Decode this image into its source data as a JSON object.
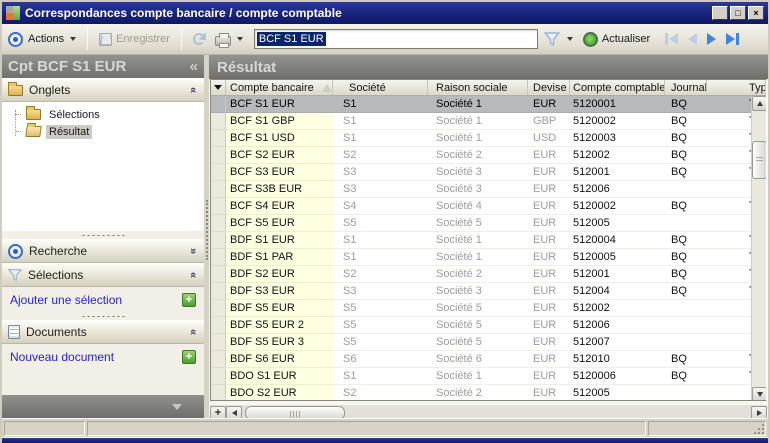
{
  "window": {
    "title": "Correspondances compte bancaire / compte comptable",
    "controls": {
      "minimize": "_",
      "maximize": "□",
      "close": "×"
    }
  },
  "toolbar": {
    "actions_label": "Actions",
    "save_label": "Enregistrer",
    "filter_value": "BCF S1 EUR",
    "refresh_label": "Actualiser"
  },
  "icons": {
    "collapse": "«",
    "expand": "»",
    "plus": "+",
    "sidebar_collapse": "«"
  },
  "sidebar": {
    "header_title": "Cpt BCF S1 EUR",
    "onglets": {
      "title": "Onglets",
      "items": [
        {
          "label": "Sélections",
          "selected": false
        },
        {
          "label": "Résultat",
          "selected": true
        }
      ]
    },
    "recherche": {
      "title": "Recherche"
    },
    "selections": {
      "title": "Sélections",
      "action_label": "Ajouter une sélection"
    },
    "documents": {
      "title": "Documents",
      "action_label": "Nouveau document"
    }
  },
  "main": {
    "header": "Résultat",
    "table": {
      "column_keys": [
        "account",
        "company",
        "company_name",
        "currency",
        "ledger_account",
        "journal",
        "type"
      ],
      "columns": [
        {
          "key": "account",
          "label": "Compte bancaire",
          "sorted": true
        },
        {
          "key": "company",
          "label": "Société",
          "sorted": false
        },
        {
          "key": "company_name",
          "label": "Raison sociale",
          "sorted": false
        },
        {
          "key": "currency",
          "label": "Devise",
          "sorted": false
        },
        {
          "key": "ledger_account",
          "label": "Compte comptable",
          "sorted": false
        },
        {
          "key": "journal",
          "label": "Journal",
          "sorted": false
        },
        {
          "key": "type",
          "label": "Typ",
          "sorted": false
        }
      ],
      "rows": [
        {
          "account": "BCF S1 EUR",
          "company": "S1",
          "company_name": "Société 1",
          "currency": "EUR",
          "ledger_account": "5120001",
          "journal": "BQ",
          "type": "T",
          "selected": true
        },
        {
          "account": "BCF S1 GBP",
          "company": "S1",
          "company_name": "Société 1",
          "currency": "GBP",
          "ledger_account": "5120002",
          "journal": "BQ",
          "type": "T",
          "selected": false
        },
        {
          "account": "BCF S1 USD",
          "company": "S1",
          "company_name": "Société 1",
          "currency": "USD",
          "ledger_account": "5120003",
          "journal": "BQ",
          "type": "T",
          "selected": false
        },
        {
          "account": "BCF S2 EUR",
          "company": "S2",
          "company_name": "Société 2",
          "currency": "EUR",
          "ledger_account": "512002",
          "journal": "BQ",
          "type": "T",
          "selected": false
        },
        {
          "account": "BCF S3 EUR",
          "company": "S3",
          "company_name": "Société 3",
          "currency": "EUR",
          "ledger_account": "512001",
          "journal": "BQ",
          "type": "T",
          "selected": false
        },
        {
          "account": "BCF S3B EUR",
          "company": "S3",
          "company_name": "Société 3",
          "currency": "EUR",
          "ledger_account": "512006",
          "journal": "",
          "type": "",
          "selected": false
        },
        {
          "account": "BCF S4 EUR",
          "company": "S4",
          "company_name": "Société 4",
          "currency": "EUR",
          "ledger_account": "5120002",
          "journal": "BQ",
          "type": "T",
          "selected": false
        },
        {
          "account": "BCF S5 EUR",
          "company": "S5",
          "company_name": "Société 5",
          "currency": "EUR",
          "ledger_account": "512005",
          "journal": "",
          "type": "",
          "selected": false
        },
        {
          "account": "BDF S1 EUR",
          "company": "S1",
          "company_name": "Société 1",
          "currency": "EUR",
          "ledger_account": "5120004",
          "journal": "BQ",
          "type": "T",
          "selected": false
        },
        {
          "account": "BDF S1 PAR",
          "company": "S1",
          "company_name": "Société 1",
          "currency": "EUR",
          "ledger_account": "5120005",
          "journal": "BQ",
          "type": "T",
          "selected": false
        },
        {
          "account": "BDF S2 EUR",
          "company": "S2",
          "company_name": "Société 2",
          "currency": "EUR",
          "ledger_account": "512001",
          "journal": "BQ",
          "type": "T",
          "selected": false
        },
        {
          "account": "BDF S3 EUR",
          "company": "S3",
          "company_name": "Société 3",
          "currency": "EUR",
          "ledger_account": "512004",
          "journal": "BQ",
          "type": "T",
          "selected": false
        },
        {
          "account": "BDF S5 EUR",
          "company": "S5",
          "company_name": "Société 5",
          "currency": "EUR",
          "ledger_account": "512002",
          "journal": "",
          "type": "",
          "selected": false
        },
        {
          "account": "BDF S5 EUR 2",
          "company": "S5",
          "company_name": "Société 5",
          "currency": "EUR",
          "ledger_account": "512006",
          "journal": "",
          "type": "",
          "selected": false
        },
        {
          "account": "BDF S5 EUR 3",
          "company": "S5",
          "company_name": "Société 5",
          "currency": "EUR",
          "ledger_account": "512007",
          "journal": "",
          "type": "",
          "selected": false
        },
        {
          "account": "BDF S6 EUR",
          "company": "S6",
          "company_name": "Société 6",
          "currency": "EUR",
          "ledger_account": "512010",
          "journal": "BQ",
          "type": "T",
          "selected": false
        },
        {
          "account": "BDO S1 EUR",
          "company": "S1",
          "company_name": "Société 1",
          "currency": "EUR",
          "ledger_account": "5120006",
          "journal": "BQ",
          "type": "T",
          "selected": false
        },
        {
          "account": "BDO S2 EUR",
          "company": "S2",
          "company_name": "Société 2",
          "currency": "EUR",
          "ledger_account": "512005",
          "journal": "",
          "type": "",
          "selected": false
        }
      ]
    }
  },
  "colors": {
    "titlebar": "#16227c",
    "selected_row": "#b7babd",
    "key_column": "#ffffe1",
    "link": "#2424cc",
    "accent_blue": "#3f84e4",
    "header_gray": "#70706c"
  }
}
